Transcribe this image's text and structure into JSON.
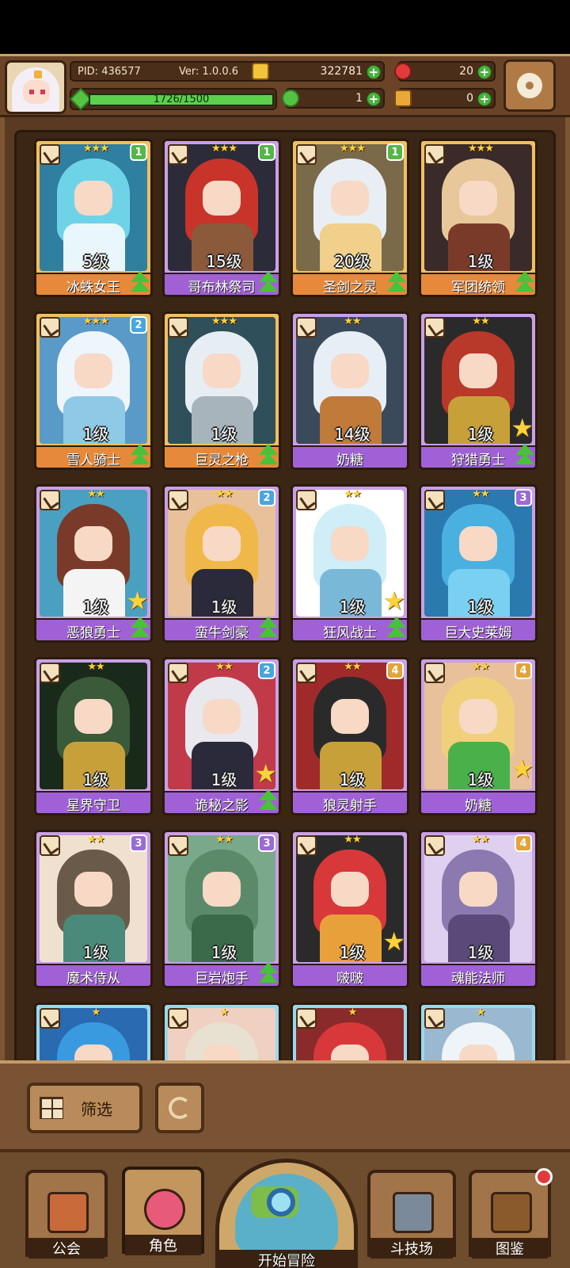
{
  "header": {
    "pid": "PID: 436577",
    "version": "Ver: 1.0.0.6",
    "xp_text": "1726/1500",
    "xp_fraction": 1.0,
    "gold": "322781",
    "gems": "20",
    "clover": "1",
    "key": "0"
  },
  "icons": {
    "gold": "gold-coin-icon",
    "gem": "red-gem-icon",
    "clover": "clover-icon",
    "key": "key-icon",
    "settings": "gear-icon"
  },
  "colors": {
    "gold_frame": "#f0c060",
    "purple_frame": "#c9a0e6",
    "blue_frame": "#9ad8ee",
    "upgrade_green": "#48c23a"
  },
  "heroes": [
    {
      "name": "冰蛛女王",
      "level": "5级",
      "stars": "★★★",
      "badge": "1",
      "rarity": "gold",
      "badge_color": "green",
      "art": [
        "#6fd3e8",
        "#e9f6fb",
        "#2f7fa0"
      ],
      "upgrade": true,
      "star": false
    },
    {
      "name": "哥布林祭司",
      "level": "15级",
      "stars": "★★★",
      "badge": "1",
      "rarity": "purple",
      "badge_color": "green",
      "art": [
        "#c8332a",
        "#8a5a3a",
        "#2b2b3a"
      ],
      "upgrade": true,
      "star": false
    },
    {
      "name": "圣剑之灵",
      "level": "20级",
      "stars": "★★★",
      "badge": "1",
      "rarity": "gold",
      "badge_color": "green",
      "art": [
        "#e8eef4",
        "#f0d08a",
        "#7a6a4a"
      ],
      "upgrade": true,
      "star": false
    },
    {
      "name": "军团统领",
      "level": "1级",
      "stars": "★★★",
      "badge": "",
      "rarity": "gold",
      "badge_color": "",
      "art": [
        "#e8c79a",
        "#7a3a2a",
        "#3a2a2a"
      ],
      "upgrade": true,
      "star": false
    },
    {
      "name": "雪人骑士",
      "level": "1级",
      "stars": "★★★",
      "badge": "2",
      "rarity": "gold",
      "badge_color": "blue",
      "art": [
        "#eef6fb",
        "#8ec9e6",
        "#5a9ac8"
      ],
      "upgrade": true,
      "star": false
    },
    {
      "name": "巨灵之枪",
      "level": "1级",
      "stars": "★★★",
      "badge": "",
      "rarity": "gold",
      "badge_color": "",
      "art": [
        "#e6eef4",
        "#a8b4bc",
        "#2f4f5a"
      ],
      "upgrade": true,
      "star": false
    },
    {
      "name": "奶糖",
      "level": "14级",
      "stars": "★★",
      "badge": "",
      "rarity": "purple",
      "badge_color": "",
      "art": [
        "#e8eef6",
        "#c07a3a",
        "#3a4a5a"
      ],
      "upgrade": false,
      "star": false
    },
    {
      "name": "狩猎勇士",
      "level": "1级",
      "stars": "★★",
      "badge": "",
      "rarity": "purple",
      "badge_color": "",
      "art": [
        "#b8382a",
        "#c8a03a",
        "#2a2a2a"
      ],
      "upgrade": true,
      "star": true
    },
    {
      "name": "恶狼勇士",
      "level": "1级",
      "stars": "★★",
      "badge": "",
      "rarity": "purple",
      "badge_color": "",
      "art": [
        "#7a3a2a",
        "#f4f4f4",
        "#4aa0c0"
      ],
      "upgrade": true,
      "star": true
    },
    {
      "name": "蛮牛剑豪",
      "level": "1级",
      "stars": "★★",
      "badge": "2",
      "rarity": "purple",
      "badge_color": "blue",
      "art": [
        "#f0b84a",
        "#2a2a3a",
        "#e8c09a"
      ],
      "upgrade": true,
      "star": false
    },
    {
      "name": "狂风战士",
      "level": "1级",
      "stars": "★★",
      "badge": "",
      "rarity": "purple",
      "badge_color": "",
      "art": [
        "#cfeef8",
        "#7ab8d8",
        "#ffffff"
      ],
      "upgrade": true,
      "star": true
    },
    {
      "name": "巨大史莱姆",
      "level": "1级",
      "stars": "★★",
      "badge": "3",
      "rarity": "purple",
      "badge_color": "purple",
      "art": [
        "#4ab0e0",
        "#7ad0f0",
        "#2a7ab0"
      ],
      "upgrade": false,
      "star": false
    },
    {
      "name": "星界守卫",
      "level": "1级",
      "stars": "★★",
      "badge": "",
      "rarity": "purple",
      "badge_color": "",
      "art": [
        "#3a5a3a",
        "#c8a03a",
        "#1a2a1a"
      ],
      "upgrade": false,
      "star": false
    },
    {
      "name": "诡秘之影",
      "level": "1级",
      "stars": "★★",
      "badge": "2",
      "rarity": "purple",
      "badge_color": "blue",
      "art": [
        "#e8e8ee",
        "#2a2a3a",
        "#c03a4a"
      ],
      "upgrade": true,
      "star": true
    },
    {
      "name": "狼灵射手",
      "level": "1级",
      "stars": "★★",
      "badge": "4",
      "rarity": "purple",
      "badge_color": "orange",
      "art": [
        "#2a2a2a",
        "#c8a03a",
        "#a02a2a"
      ],
      "upgrade": false,
      "star": false
    },
    {
      "name": "奶糖",
      "level": "1级",
      "stars": "★★",
      "badge": "4",
      "rarity": "purple",
      "badge_color": "orange",
      "art": [
        "#f0d07a",
        "#4ab04a",
        "#e8c09a"
      ],
      "upgrade": false,
      "star": true
    },
    {
      "name": "魔术侍从",
      "level": "1级",
      "stars": "★★",
      "badge": "3",
      "rarity": "purple",
      "badge_color": "purple",
      "art": [
        "#6a5a4a",
        "#4a8a7a",
        "#f0e0d0"
      ],
      "upgrade": false,
      "star": false
    },
    {
      "name": "巨岩炮手",
      "level": "1级",
      "stars": "★★",
      "badge": "3",
      "rarity": "purple",
      "badge_color": "purple",
      "art": [
        "#5a8a6a",
        "#3a6a4a",
        "#7aa88a"
      ],
      "upgrade": true,
      "star": false
    },
    {
      "name": "啵啵",
      "level": "1级",
      "stars": "★★",
      "badge": "",
      "rarity": "purple",
      "badge_color": "",
      "art": [
        "#d8383a",
        "#e8a03a",
        "#2a2a2a"
      ],
      "upgrade": false,
      "star": true
    },
    {
      "name": "魂能法师",
      "level": "1级",
      "stars": "★★",
      "badge": "4",
      "rarity": "purple",
      "badge_color": "orange",
      "art": [
        "#8a7ab0",
        "#5a4a7a",
        "#e0d0f0"
      ],
      "upgrade": false,
      "star": false
    },
    {
      "name": "",
      "level": "",
      "stars": "★",
      "badge": "",
      "rarity": "blue",
      "badge_color": "",
      "art": [
        "#3a9ae0",
        "#f0d0c0",
        "#2a6ab0"
      ],
      "upgrade": false,
      "star": false
    },
    {
      "name": "",
      "level": "",
      "stars": "★",
      "badge": "",
      "rarity": "blue",
      "badge_color": "",
      "art": [
        "#e8e0d0",
        "#c08a5a",
        "#f0d0c0"
      ],
      "upgrade": false,
      "star": false
    },
    {
      "name": "",
      "level": "",
      "stars": "★",
      "badge": "",
      "rarity": "blue",
      "badge_color": "",
      "art": [
        "#d8383a",
        "#f0d0c0",
        "#8a2a2a"
      ],
      "upgrade": false,
      "star": false
    },
    {
      "name": "",
      "level": "",
      "stars": "★",
      "badge": "",
      "rarity": "blue",
      "badge_color": "",
      "art": [
        "#eef4f8",
        "#c8d8e8",
        "#9ab8d0"
      ],
      "upgrade": false,
      "star": false
    }
  ],
  "toolbar": {
    "filter_label": "筛选",
    "filter_icon": "grid-filter-icon",
    "refresh_icon": "refresh-icon"
  },
  "nav": {
    "guild": "公会",
    "character": "角色",
    "adventure": "开始冒险",
    "arena": "斗技场",
    "codex": "图鉴",
    "selected": "character"
  }
}
